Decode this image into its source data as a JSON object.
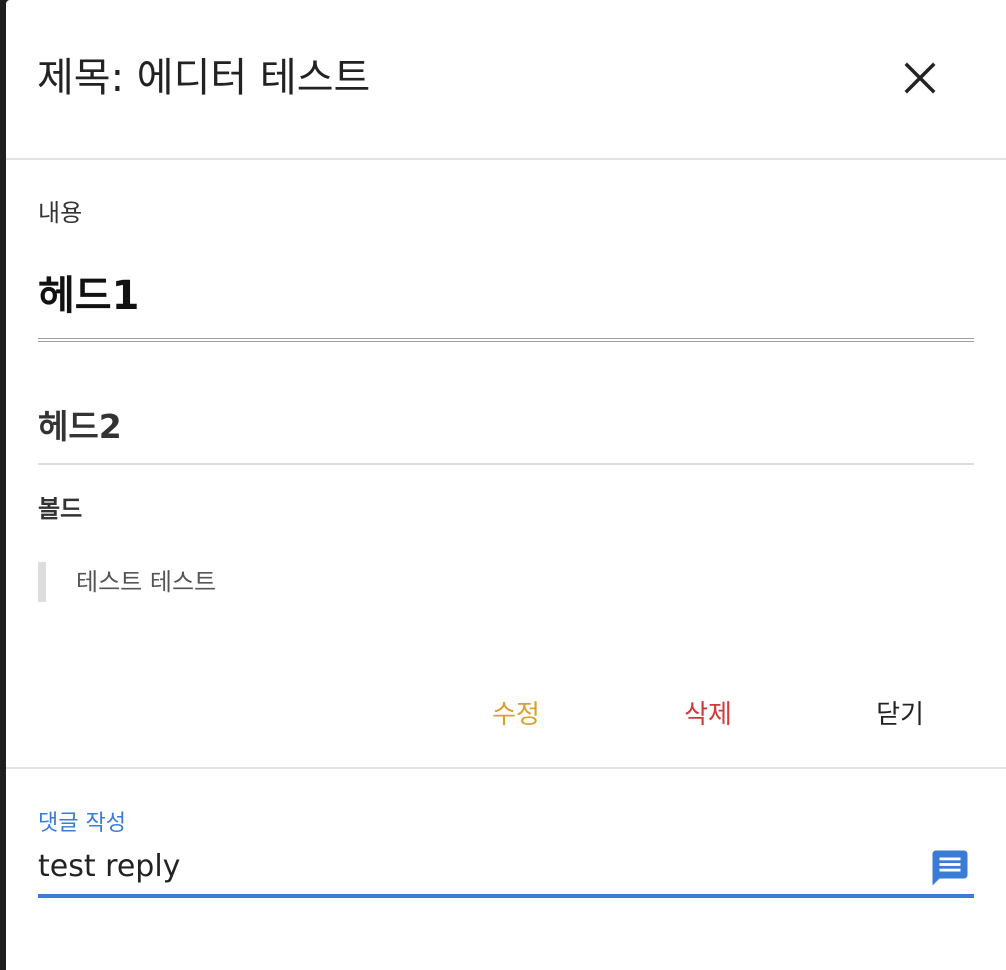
{
  "dialog": {
    "title": "제목: 에디터 테스트",
    "close_icon": "close-icon"
  },
  "content": {
    "label": "내용",
    "heading1": "헤드1",
    "heading2": "헤드2",
    "bold_text": "볼드",
    "blockquote": "테스트 테스트"
  },
  "actions": {
    "edit_label": "수정",
    "delete_label": "삭제",
    "close_label": "닫기",
    "colors": {
      "edit": "#d9a030",
      "delete": "#d23a3a",
      "close": "#222222"
    }
  },
  "reply": {
    "label": "댓글 작성",
    "value": "test reply",
    "send_icon": "comment-icon",
    "accent_color": "#3a7bd5"
  }
}
